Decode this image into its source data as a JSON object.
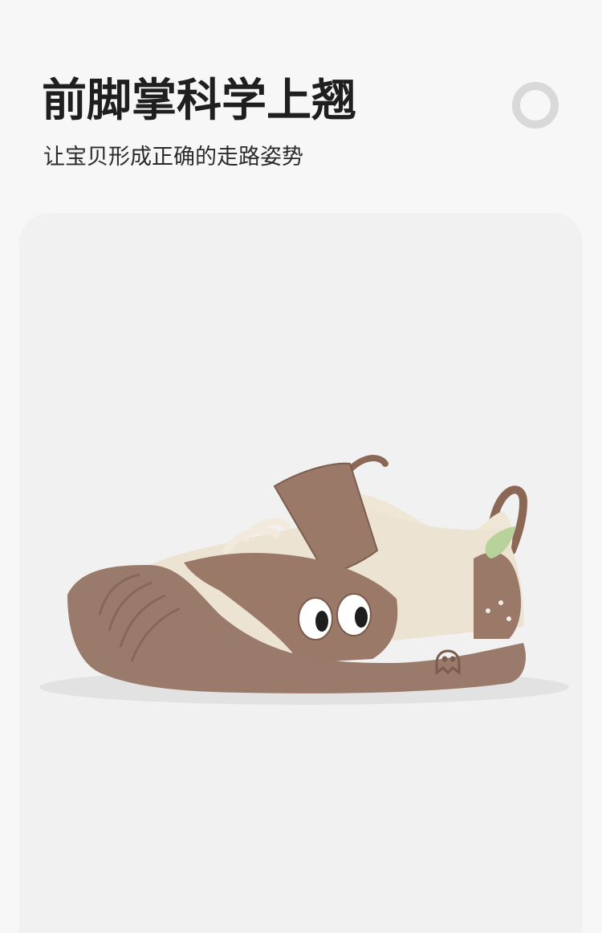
{
  "header": {
    "title": "前脚掌科学上翘",
    "subtitle": "让宝贝形成正确的走路姿势"
  },
  "product": {
    "image": "toddler-shoe-side-view",
    "colors": {
      "sole": "#9a7a6a",
      "upper_cream": "#efe6d6",
      "accent_brown": "#8c6a58",
      "leaf_green": "#a9c98a"
    }
  }
}
